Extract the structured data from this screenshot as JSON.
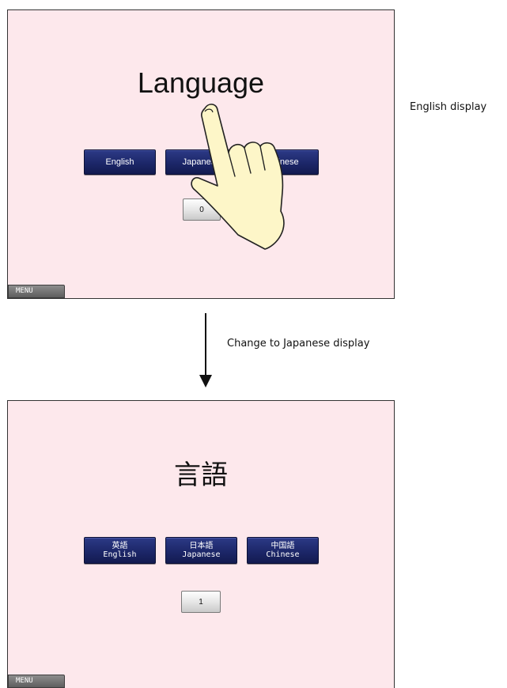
{
  "annotations": {
    "top_label": "English display",
    "transition_label": "Change to Japanese display"
  },
  "screen_english": {
    "title": "Language",
    "buttons": {
      "english": "English",
      "japanese": "Japanese",
      "chinese": "Chinese"
    },
    "display_value": "0",
    "menu_label": "MENU"
  },
  "screen_japanese": {
    "title": "言語",
    "buttons": {
      "english_line1": "英語",
      "english_line2": "English",
      "japanese_line1": "日本語",
      "japanese_line2": "Japanese",
      "chinese_line1": "中国語",
      "chinese_line2": "Chinese"
    },
    "display_value": "1",
    "menu_label": "MENU"
  },
  "icons": {
    "pointer": "pointing-hand-icon",
    "flow": "arrow-down-icon"
  },
  "colors": {
    "screen_background": "#fde8ec",
    "language_button": "#1b2566",
    "menu_button": "#6e6e6e",
    "hand_fill": "#fdf6c8"
  }
}
